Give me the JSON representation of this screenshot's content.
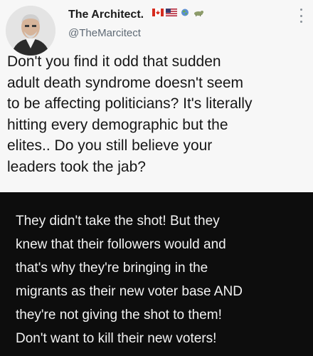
{
  "tweet": {
    "display_name": "The Architect.",
    "handle": "@TheMarcitect",
    "flag_icons": [
      "canada-flag-icon",
      "usa-flag-icon",
      "globe-icon",
      "animal-icon"
    ],
    "text_lines": [
      "Don't you find it odd that sudden",
      "adult death syndrome doesn't seem",
      "to be affecting politicians? It's literally",
      "hitting every demographic but the",
      "elites.. Do you still believe your",
      "leaders took the jab?"
    ]
  },
  "reply": {
    "text_lines": [
      "They didn't take the shot! But they",
      "knew that their followers would and",
      "that's why they're bringing in the",
      "migrants as their new voter base AND",
      "they're not giving the shot to them!",
      "Don't want to kill their new voters!"
    ]
  },
  "colors": {
    "tweet_background": "#f7f7f7",
    "reply_background": "#0d0d0d",
    "reply_text": "#f2f2f2",
    "handle_text": "#5f6a75"
  }
}
